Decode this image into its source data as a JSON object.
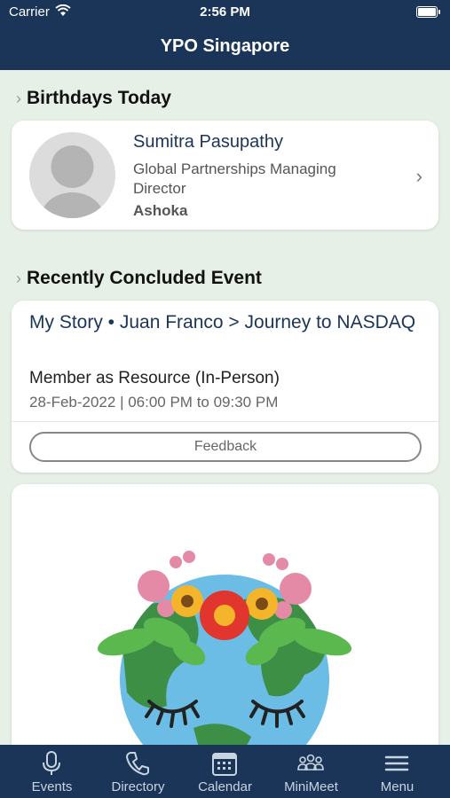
{
  "status_bar": {
    "carrier": "Carrier",
    "time": "2:56 PM"
  },
  "nav": {
    "title": "YPO Singapore"
  },
  "birthdays": {
    "section_title": "Birthdays Today",
    "person": {
      "name": "Sumitra Pasupathy",
      "role": "Global Partnerships Managing Director",
      "organization": "Ashoka"
    }
  },
  "recent_event": {
    "section_title": "Recently Concluded Event",
    "title": "My Story • Juan Franco > Journey to NASDAQ",
    "type": "Member as Resource (In-Person)",
    "datetime": "28-Feb-2022 | 06:00 PM to 09:30 PM",
    "feedback_label": "Feedback"
  },
  "banner": {
    "icon": "earth-with-flower-crown-illustration"
  },
  "tabs": [
    {
      "label": "Events",
      "icon": "microphone-icon"
    },
    {
      "label": "Directory",
      "icon": "phone-icon"
    },
    {
      "label": "Calendar",
      "icon": "calendar-icon"
    },
    {
      "label": "MiniMeet",
      "icon": "group-icon"
    },
    {
      "label": "Menu",
      "icon": "menu-icon"
    }
  ],
  "colors": {
    "nav_bg": "#1a3557",
    "page_bg": "#e6f0e6",
    "link": "#1a3557"
  }
}
